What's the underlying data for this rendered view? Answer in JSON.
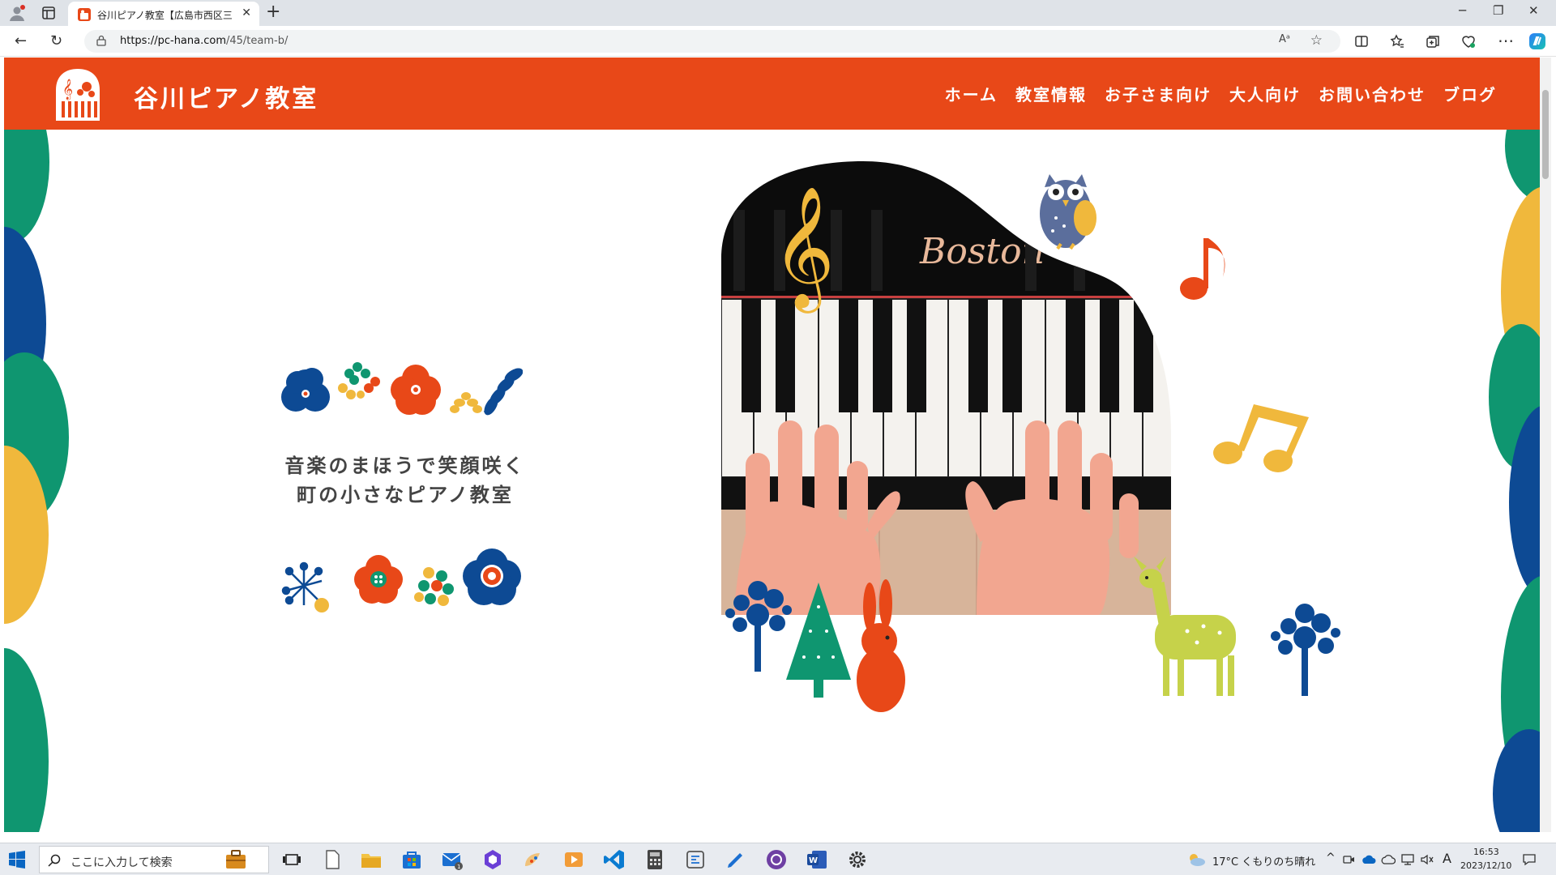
{
  "browser": {
    "tab_title": "谷川ピアノ教室【広島市西区三滝】",
    "url_host": "https://pc-hana.com",
    "url_path": "/45/team-b/",
    "read_aloud": "Aᵃ"
  },
  "site": {
    "title": "谷川ピアノ教室",
    "nav": [
      "ホーム",
      "教室情報",
      "お子さま向け",
      "大人向け",
      "お問い合わせ",
      "ブログ"
    ],
    "tagline_1": "音楽のまほうで笑顔咲く",
    "tagline_2": "町の小さなピアノ教室",
    "piano_brand": "Boston",
    "colors": {
      "header": "#e84818",
      "green": "#0f9670",
      "blue": "#0d4a94",
      "yellow": "#f0b83c"
    }
  },
  "taskbar": {
    "search_placeholder": "ここに入力して検索",
    "weather": "17°C くもりのち晴れ",
    "ime": "A",
    "time": "16:53",
    "date": "2023/12/10"
  }
}
